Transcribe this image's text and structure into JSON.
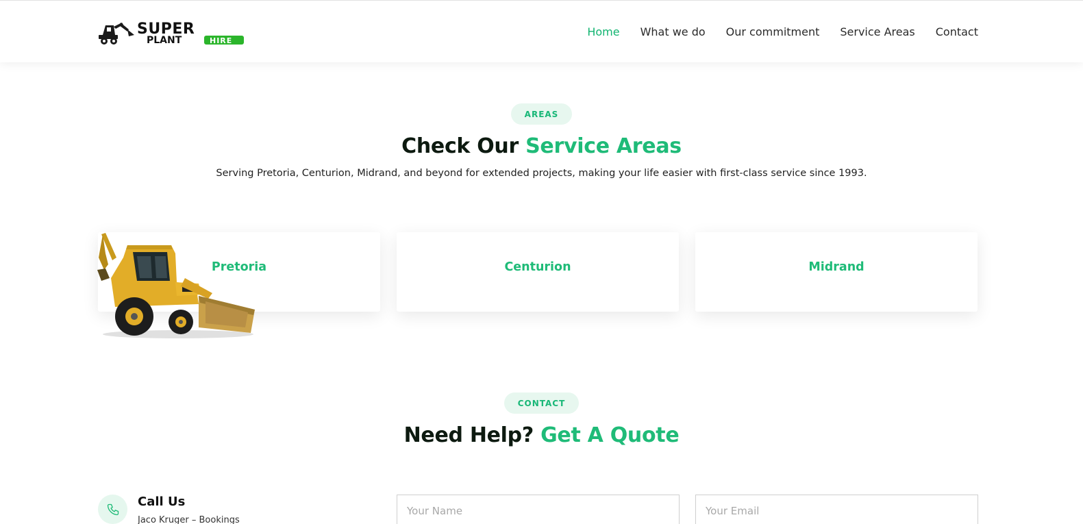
{
  "brand": {
    "logo_text_top": "SUPER",
    "logo_text_bottom": "PLANT",
    "logo_badge": "HIRE",
    "accent_color": "#1fbb78",
    "badge_color": "#2bb52b"
  },
  "nav": {
    "items": [
      {
        "label": "Home",
        "active": true
      },
      {
        "label": "What we do",
        "active": false
      },
      {
        "label": "Our commitment",
        "active": false
      },
      {
        "label": "Service Areas",
        "active": false
      },
      {
        "label": "Contact",
        "active": false
      }
    ]
  },
  "areas": {
    "pill": "AREAS",
    "heading_plain": "Check Our ",
    "heading_accent": "Service Areas",
    "subtitle": "Serving Pretoria, Centurion, Midrand, and beyond for extended projects, making your life easier with first-class service since 1993.",
    "cards": [
      "Pretoria",
      "Centurion",
      "Midrand"
    ]
  },
  "contact": {
    "pill": "CONTACT",
    "heading_plain": "Need Help? ",
    "heading_accent": "Get A Quote",
    "call_title": "Call Us",
    "call_subtitle": "Jaco Kruger – Bookings",
    "form": {
      "name_placeholder": "Your Name",
      "email_placeholder": "Your Email"
    }
  },
  "icons": {
    "phone": "phone-icon",
    "backhoe": "backhoe-loader-illustration"
  }
}
